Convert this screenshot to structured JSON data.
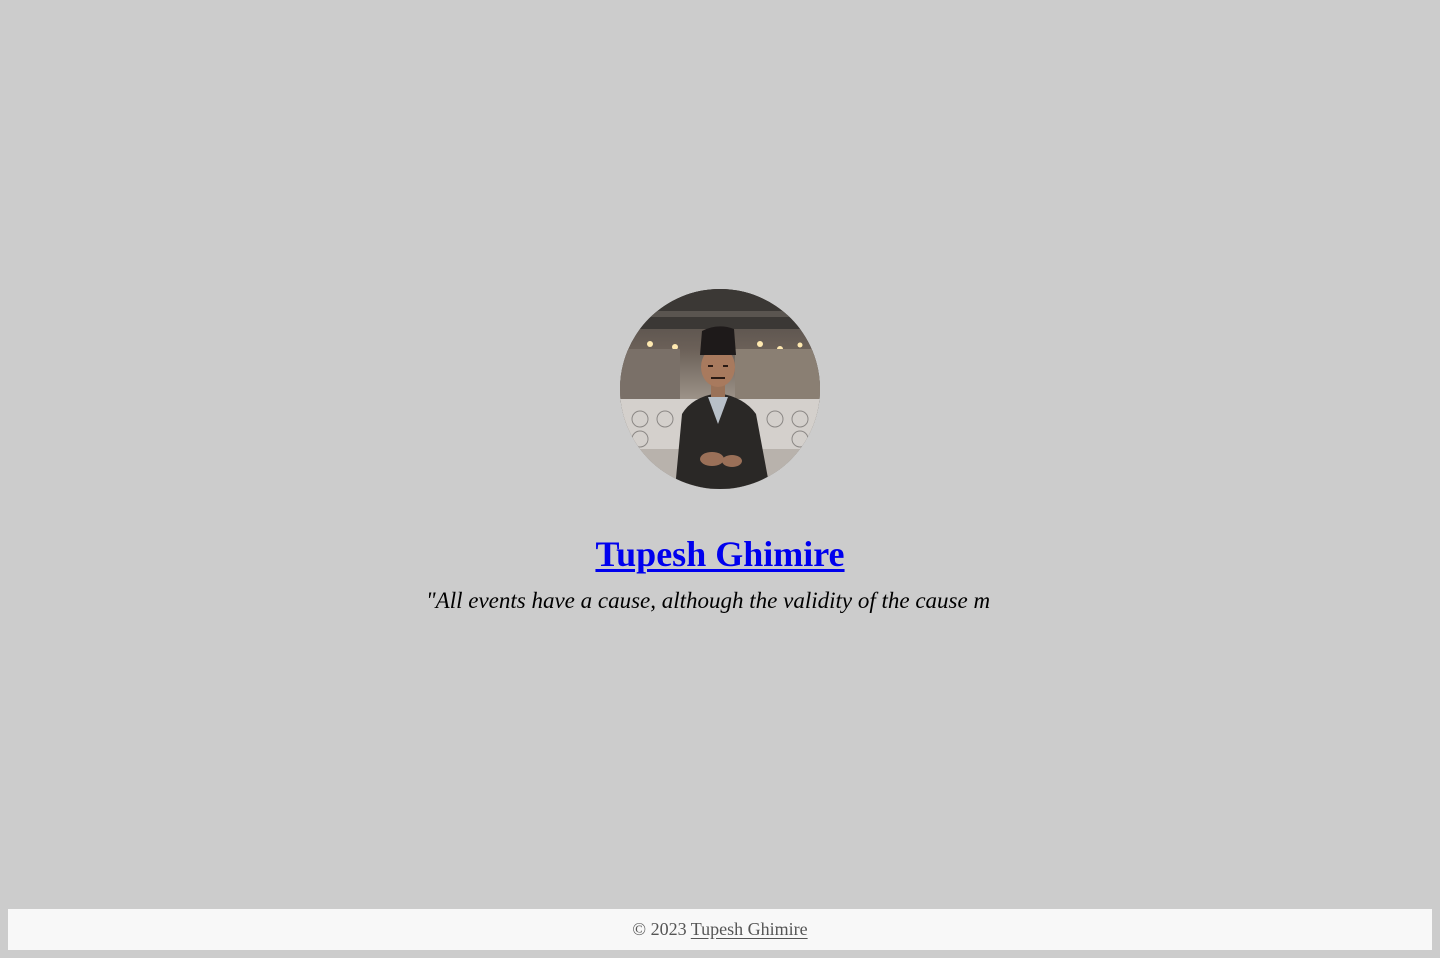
{
  "profile": {
    "avatar_alt": "profile-photo",
    "name": "Tupesh Ghimire",
    "quote": "\"All events have a cause, although the validity of the cause m"
  },
  "footer": {
    "copyright_prefix": "© 2023",
    "author_link": "Tupesh Ghimire"
  },
  "colors": {
    "background": "#cccccc",
    "link": "#0000ee",
    "footer_bg": "#f8f8f8",
    "footer_text": "#555555"
  }
}
